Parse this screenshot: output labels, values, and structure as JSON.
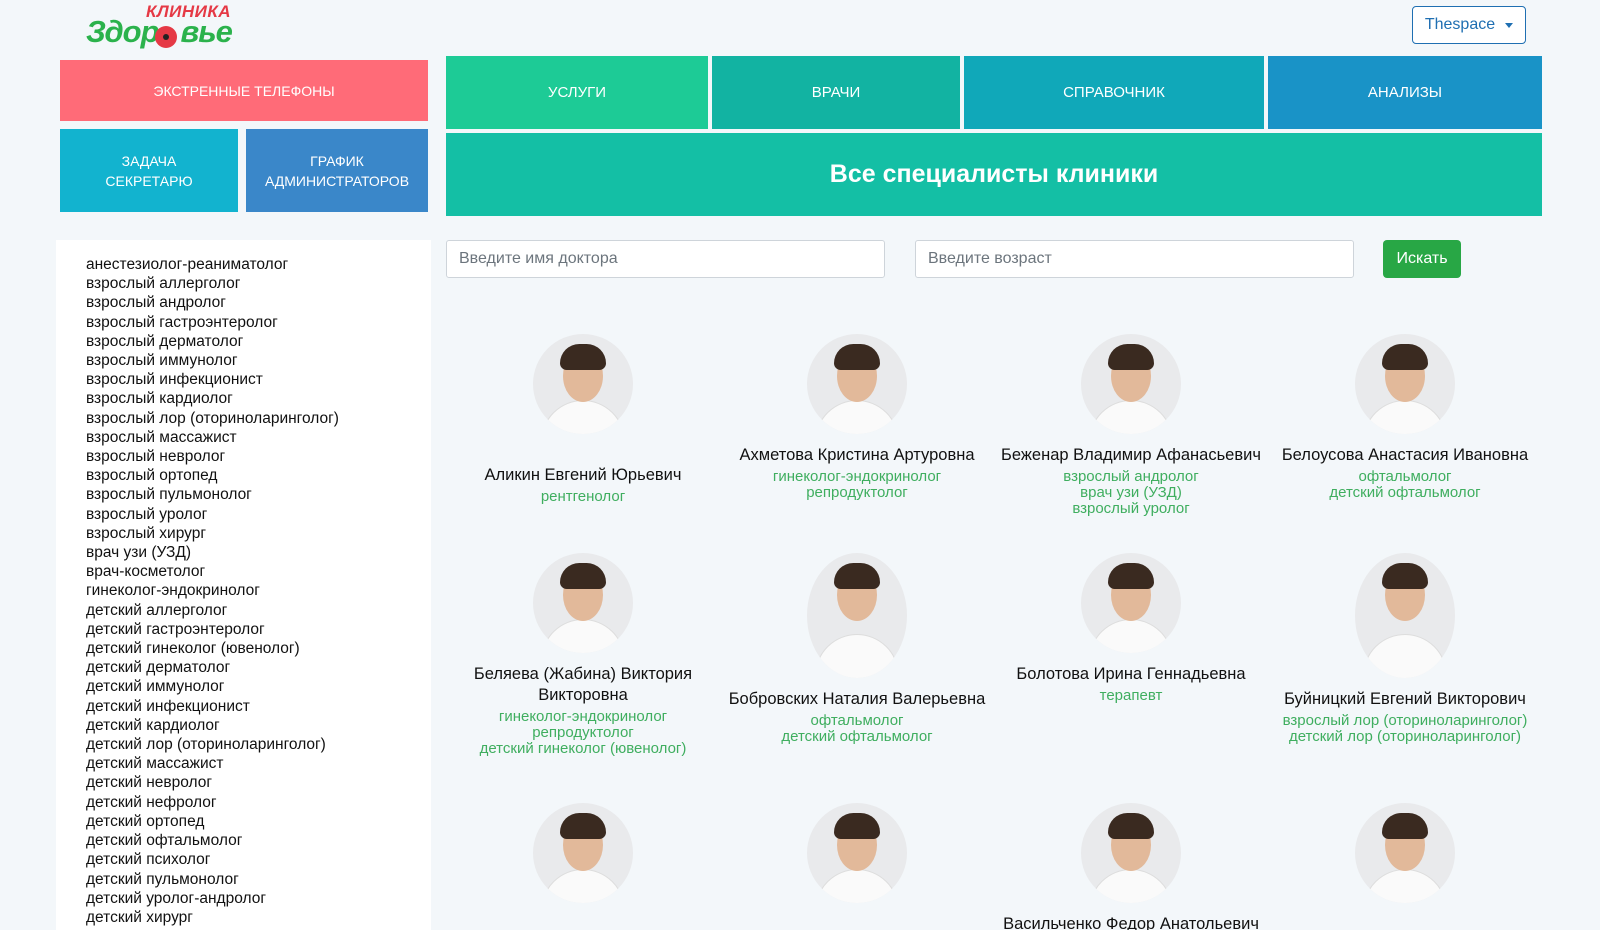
{
  "logo": {
    "top": "КЛИНИКА",
    "main_left": "Здор",
    "main_right": "вье"
  },
  "user_menu": {
    "label": "Thespace"
  },
  "quick": {
    "emergency": "ЭКСТРЕННЫЕ ТЕЛЕФОНЫ",
    "task_line1": "ЗАДАЧА",
    "task_line2": "СЕКРЕТАРЮ",
    "schedule_line1": "ГРАФИК",
    "schedule_line2": "АДМИНИСТРАТОРОВ"
  },
  "nav": {
    "services": "УСЛУГИ",
    "doctors": "ВРАЧИ",
    "reference": "СПРАВОЧНИК",
    "tests": "АНАЛИЗЫ"
  },
  "banner": {
    "title": "Все специалисты клиники"
  },
  "search": {
    "name_placeholder": "Введите имя доктора",
    "age_placeholder": "Введите возраст",
    "button": "Искать"
  },
  "specialties": [
    "анестезиолог-реаниматолог",
    "взрослый аллерголог",
    "взрослый андролог",
    "взрослый гастроэнтеролог",
    "взрослый дерматолог",
    "взрослый иммунолог",
    "взрослый инфекционист",
    "взрослый кардиолог",
    "взрослый лор (оториноларинголог)",
    "взрослый массажист",
    "взрослый невролог",
    "взрослый ортопед",
    "взрослый пульмонолог",
    "взрослый уролог",
    "взрослый хирург",
    "врач узи (УЗД)",
    "врач-косметолог",
    "гинеколог-эндокринолог",
    "детский аллерголог",
    "детский гастроэнтеролог",
    "детский гинеколог (ювенолог)",
    "детский дерматолог",
    "детский иммунолог",
    "детский инфекционист",
    "детский кардиолог",
    "детский лор (оториноларинголог)",
    "детский массажист",
    "детский невролог",
    "детский нефролог",
    "детский ортопед",
    "детский офтальмолог",
    "детский психолог",
    "детский пульмонолог",
    "детский уролог-андролог",
    "детский хирург"
  ],
  "doctors": [
    {
      "name": "Аликин Евгений Юрьевич",
      "specs": [
        "рентгенолог"
      ]
    },
    {
      "name": "Ахметова Кристина Артуровна",
      "specs": [
        "гинеколог-эндокринолог",
        "репродуктолог"
      ]
    },
    {
      "name": "Беженар Владимир Афанасьевич",
      "specs": [
        "взрослый андролог",
        "врач узи (УЗД)",
        "взрослый уролог"
      ]
    },
    {
      "name": "Белоусова Анастасия Ивановна",
      "specs": [
        "офтальмолог",
        "детский офтальмолог"
      ]
    },
    {
      "name": "Беляева (Жабина) Виктория Викторовна",
      "specs": [
        "гинеколог-эндокринолог",
        "репродуктолог",
        "детский гинеколог (ювенолог)"
      ]
    },
    {
      "name": "Бобровских Наталия Валерьевна",
      "specs": [
        "офтальмолог",
        "детский офтальмолог"
      ]
    },
    {
      "name": "Болотова Ирина Геннадьевна",
      "specs": [
        "терапевт"
      ]
    },
    {
      "name": "Буйницкий Евгений Викторович",
      "specs": [
        "взрослый лор (оториноларинголог)",
        "детский лор (оториноларинголог)"
      ]
    },
    {
      "name": "",
      "specs": []
    },
    {
      "name": "",
      "specs": []
    },
    {
      "name": "Васильченко Федор Анатольевич",
      "specs": []
    },
    {
      "name": "",
      "specs": []
    }
  ],
  "colors": {
    "emergency": "#ff6b78",
    "accent": "#14bfa5",
    "spec_text": "#3fae5f",
    "search_button": "#28a745"
  }
}
